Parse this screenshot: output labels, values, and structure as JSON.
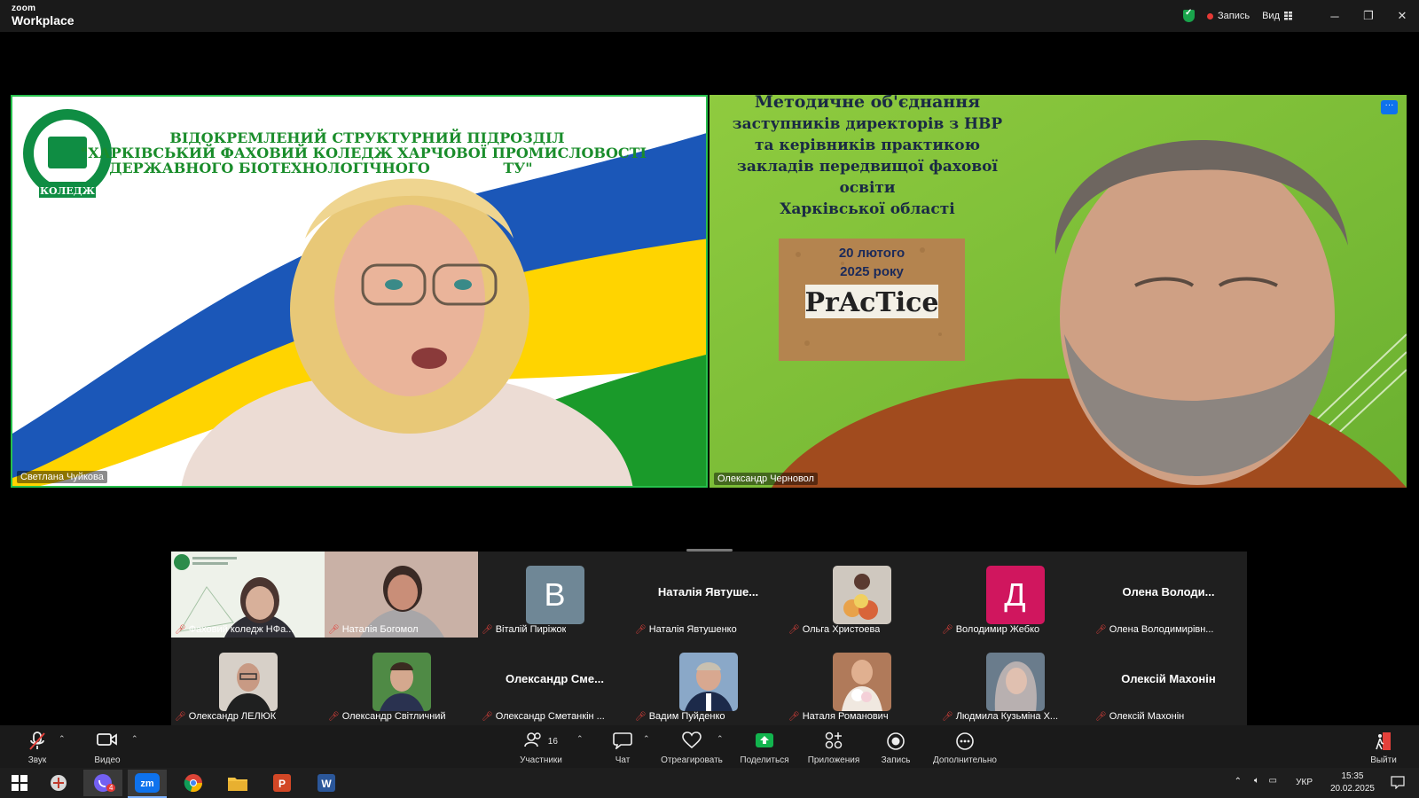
{
  "app": {
    "brand_small": "zoom",
    "brand_large": "Workplace"
  },
  "titlebar": {
    "record_label": "Запись",
    "view_label": "Вид"
  },
  "speakers": [
    {
      "name": "Светлана Чуйкова"
    },
    {
      "name": "Олександр Черновол"
    }
  ],
  "left_background": {
    "line1": "ВІДОКРЕМЛЕНИЙ СТРУКТУРНИЙ ПІДРОЗДІЛ",
    "line2": "\"ХАРКІВСЬКИЙ ФАХОВИЙ КОЛЕДЖ ХАРЧОВОЇ ПРОМИСЛОВОСТІ",
    "line3": "ДЕРЖАВНОГО БІОТЕХНОЛОГІЧНОГО",
    "line3b": "ТУ\"",
    "logo_text": "КОЛЕДЖ"
  },
  "right_background": {
    "lines": [
      "Методичне об'єднання",
      "заступників директорів з НВР",
      "та керівників практикою",
      "закладів передвищої фахової",
      "освіти",
      "Харківської області"
    ],
    "board_line1": "20 лютого",
    "board_line2": "2025 року",
    "board_word": "PrAcTice"
  },
  "gallery": {
    "row1": [
      {
        "name": "Фаховий коледж НФа...",
        "kind": "video"
      },
      {
        "name": "Наталія Богомол",
        "kind": "video"
      },
      {
        "name": "Віталій Пиріжок",
        "kind": "letter",
        "letter": "В",
        "color": "#6f8796"
      },
      {
        "name": "Наталія Явтушенко",
        "kind": "text",
        "bigname": "Наталія Явтуше..."
      },
      {
        "name": "Ольга Христоева",
        "kind": "photo"
      },
      {
        "name": "Володимир Жебко",
        "kind": "letter",
        "letter": "Д",
        "color": "#d0165e"
      },
      {
        "name": "Олена Володимирівн...",
        "kind": "text",
        "bigname": "Олена Володи..."
      }
    ],
    "row2": [
      {
        "name": "Олександр ЛЕЛЮК",
        "kind": "photo"
      },
      {
        "name": "Олександр Світличний",
        "kind": "photo"
      },
      {
        "name": "Олександр Сметанкін ...",
        "kind": "text",
        "bigname": "Олександр Сме..."
      },
      {
        "name": "Вадим Пуйденко",
        "kind": "photo"
      },
      {
        "name": "Наталя Романович",
        "kind": "photo"
      },
      {
        "name": "Людмила Кузьміна Х...",
        "kind": "photo"
      },
      {
        "name": "Олексій Махонін",
        "kind": "text",
        "bigname": "Олексій Махонін"
      }
    ]
  },
  "toolbar": {
    "audio": "Звук",
    "video": "Видео",
    "participants": "Участники",
    "participants_count": "16",
    "chat": "Чат",
    "react": "Отреагировать",
    "share": "Поделиться",
    "apps": "Приложения",
    "record": "Запись",
    "more": "Дополнительно",
    "leave": "Выйти"
  },
  "taskbar": {
    "viber_badge": "4",
    "lang": "УКР",
    "time": "15:35",
    "date": "20.02.2025"
  },
  "colors": {
    "accent": "#0e72ed",
    "active_speaker": "#27c04c",
    "share_green": "#12b44e",
    "muted_red": "#e5413b"
  }
}
